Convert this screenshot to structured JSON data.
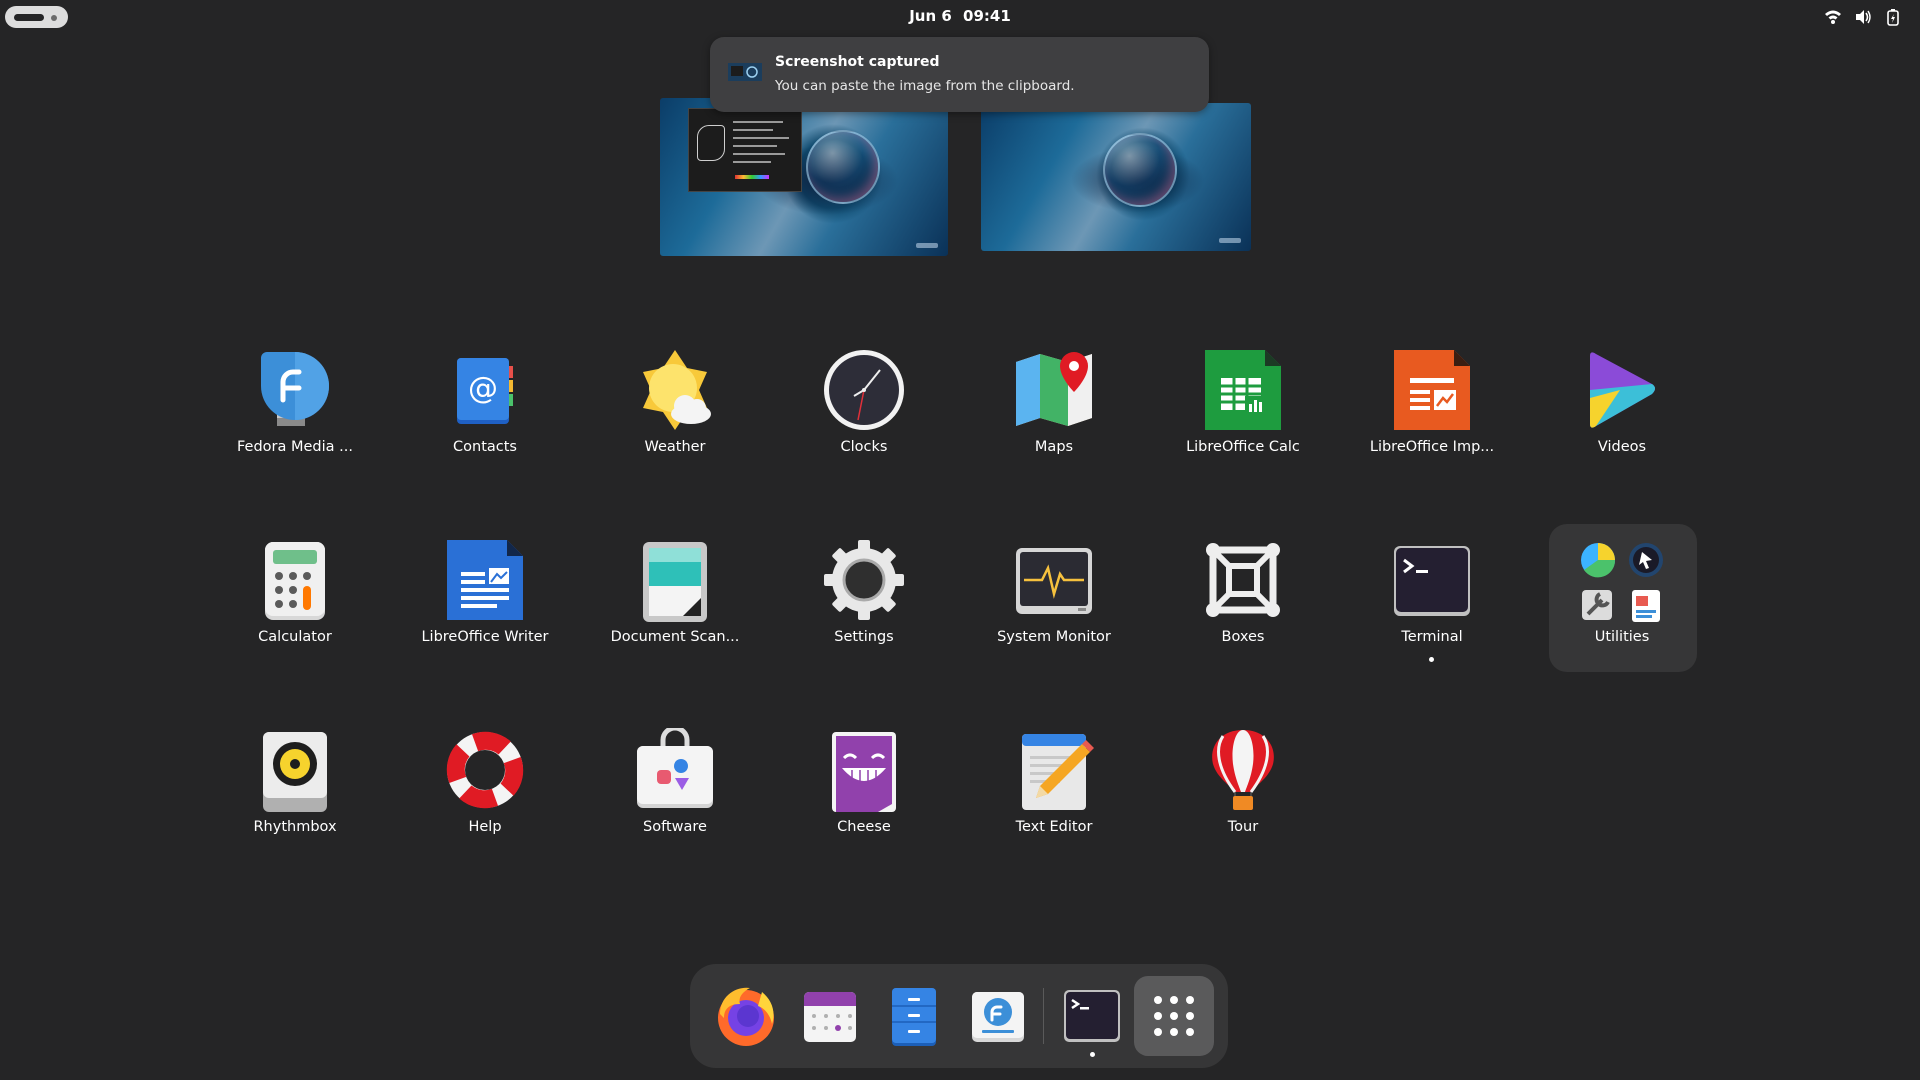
{
  "topbar": {
    "date": "Jun 6",
    "time": "09:41",
    "status_icons": [
      "wifi-icon",
      "volume-icon",
      "battery-icon"
    ]
  },
  "notification": {
    "title": "Screenshot captured",
    "body": "You can paste the image from the clipboard.",
    "icon": "screenshot-icon"
  },
  "apps": [
    {
      "label": "Fedora Media ...",
      "icon": "fedora-media-writer-icon"
    },
    {
      "label": "Contacts",
      "icon": "contacts-icon"
    },
    {
      "label": "Weather",
      "icon": "weather-icon"
    },
    {
      "label": "Clocks",
      "icon": "clocks-icon"
    },
    {
      "label": "Maps",
      "icon": "maps-icon"
    },
    {
      "label": "LibreOffice Calc",
      "icon": "libreoffice-calc-icon"
    },
    {
      "label": "LibreOffice Imp...",
      "icon": "libreoffice-impress-icon"
    },
    {
      "label": "Videos",
      "icon": "videos-icon"
    },
    {
      "label": "Calculator",
      "icon": "calculator-icon"
    },
    {
      "label": "LibreOffice Writer",
      "icon": "libreoffice-writer-icon"
    },
    {
      "label": "Document Scan...",
      "icon": "document-scanner-icon"
    },
    {
      "label": "Settings",
      "icon": "settings-icon"
    },
    {
      "label": "System Monitor",
      "icon": "system-monitor-icon"
    },
    {
      "label": "Boxes",
      "icon": "boxes-icon"
    },
    {
      "label": "Terminal",
      "icon": "terminal-icon"
    },
    {
      "label": "Utilities",
      "icon": "utilities-folder-icon"
    },
    {
      "label": "Rhythmbox",
      "icon": "rhythmbox-icon"
    },
    {
      "label": "Help",
      "icon": "help-icon"
    },
    {
      "label": "Software",
      "icon": "software-icon"
    },
    {
      "label": "Cheese",
      "icon": "cheese-icon"
    },
    {
      "label": "Text Editor",
      "icon": "text-editor-icon"
    },
    {
      "label": "Tour",
      "icon": "tour-icon"
    }
  ],
  "dash": [
    "firefox-icon",
    "calendar-icon",
    "files-icon",
    "fedora-media-writer-icon",
    "terminal-icon",
    "show-apps-icon"
  ],
  "colors": {
    "background": "#252526",
    "panel": "#363637",
    "notification": "#3f3f41"
  }
}
